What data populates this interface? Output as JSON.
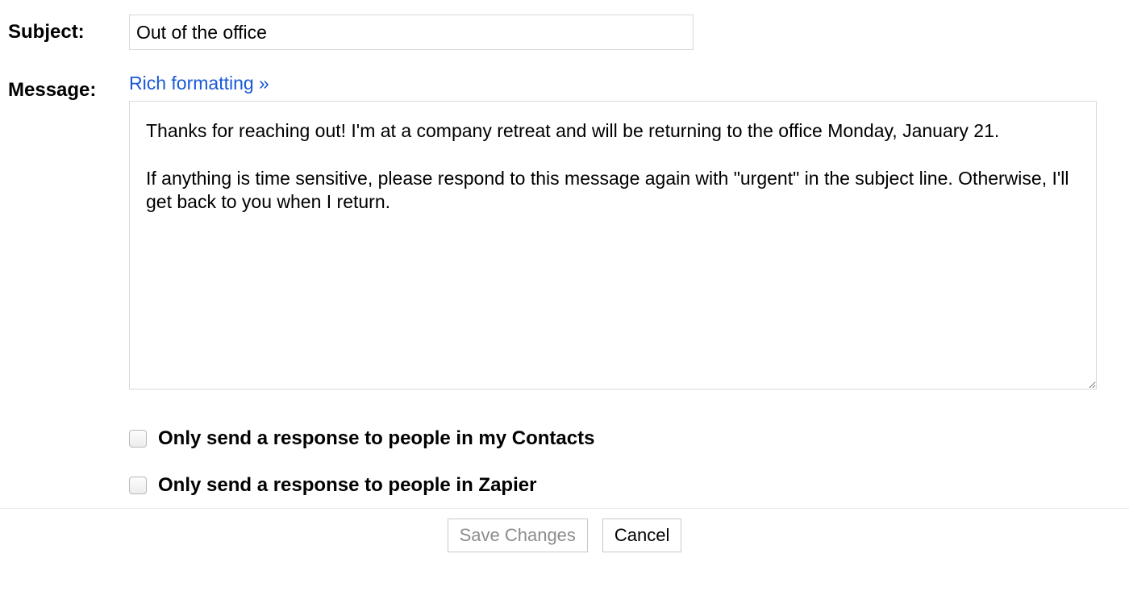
{
  "labels": {
    "subject": "Subject:",
    "message": "Message:"
  },
  "subject": {
    "value": "Out of the office"
  },
  "rich_link": "Rich formatting »",
  "message_body": "Thanks for reaching out! I'm at a company retreat and will be returning to the office Monday, January 21.\n\nIf anything is time sensitive, please respond to this message again with \"urgent\" in the subject line. Otherwise, I'll get back to you when I return.",
  "options": {
    "only_contacts": {
      "checked": false,
      "label": "Only send a response to people in my Contacts"
    },
    "only_org": {
      "checked": false,
      "label": "Only send a response to people in Zapier"
    }
  },
  "buttons": {
    "save": "Save Changes",
    "cancel": "Cancel"
  }
}
